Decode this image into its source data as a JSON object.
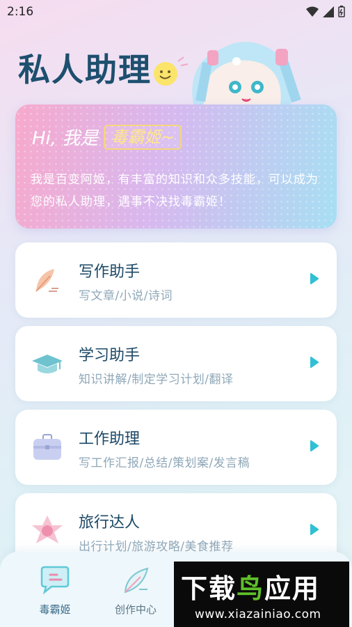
{
  "status": {
    "time": "2:16"
  },
  "header": {
    "title": "私人助理"
  },
  "intro": {
    "greeting": "Hi, 我是",
    "name": "毒霸姬~",
    "description": "我是百变阿姬，有丰富的知识和众多技能，可以成为您的私人助理，遇事不决找毒霸姬！"
  },
  "features": [
    {
      "title": "写作助手",
      "subtitle": "写文章/小说/诗词",
      "icon": "feather-pen-icon"
    },
    {
      "title": "学习助手",
      "subtitle": "知识讲解/制定学习计划/翻译",
      "icon": "graduation-cap-icon"
    },
    {
      "title": "工作助理",
      "subtitle": "写工作汇报/总结/策划案/发言稿",
      "icon": "briefcase-icon"
    },
    {
      "title": "旅行达人",
      "subtitle": "出行计划/旅游攻略/美食推荐",
      "icon": "compass-star-icon"
    }
  ],
  "nav": [
    {
      "label": "毒霸姬",
      "icon": "chat-bubble-icon",
      "active": true
    },
    {
      "label": "创作中心",
      "icon": "feather-icon",
      "active": false
    }
  ],
  "watermark": {
    "title_part1": "下载",
    "title_part2": "鸟",
    "title_part3": "应用",
    "url": "www.xiazainiao.com"
  },
  "colors": {
    "accent": "#2fc0d4",
    "title": "#1d4f6e"
  }
}
